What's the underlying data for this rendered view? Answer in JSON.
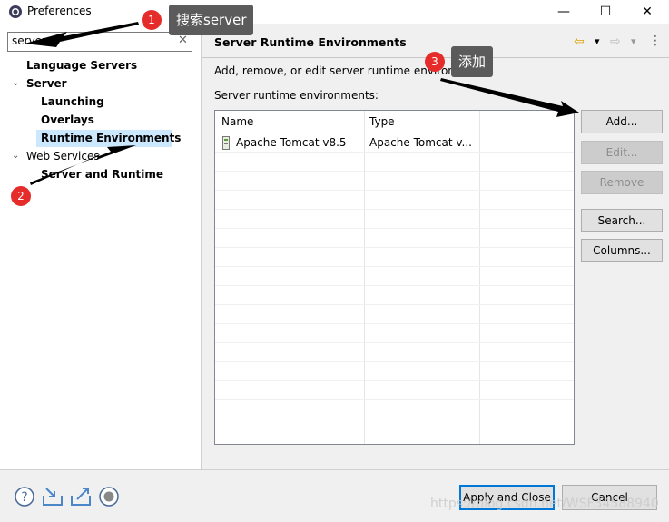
{
  "window": {
    "title": "Preferences",
    "minimize": "—",
    "maximize": "☐",
    "close": "✕"
  },
  "filter": {
    "value": "server",
    "clear": "✕"
  },
  "tree": [
    {
      "label": "Language Servers"
    },
    {
      "label": "Server",
      "chevron": "⌄"
    },
    {
      "label": "Launching"
    },
    {
      "label": "Overlays"
    },
    {
      "label": "Runtime Environments",
      "selected": true
    },
    {
      "label": "Web Services",
      "chevron": "⌄"
    },
    {
      "label": "Server and Runtime"
    }
  ],
  "page": {
    "title": "Server Runtime Environments",
    "description": "Add, remove, or edit server runtime environments.",
    "list_label": "Server runtime environments:",
    "nav": {
      "back": "⇦",
      "back_menu": "▾",
      "forward": "⇨",
      "forward_menu": "▾",
      "more": "⋮"
    }
  },
  "table": {
    "columns": [
      "Name",
      "Type"
    ],
    "rows": [
      {
        "name": "Apache Tomcat v8.5",
        "type": "Apache Tomcat v..."
      }
    ]
  },
  "buttons": {
    "add": "Add...",
    "edit": "Edit...",
    "remove": "Remove",
    "search": "Search...",
    "columns": "Columns..."
  },
  "footer": {
    "apply": "Apply and Close",
    "cancel": "Cancel",
    "watermark": "https://blog.csdn.net/WSF34588940"
  },
  "annotations": [
    {
      "num": "1",
      "text": "搜索server"
    },
    {
      "num": "2"
    },
    {
      "num": "3",
      "text": "添加"
    }
  ],
  "colors": {
    "selection": "#cce8ff",
    "default_button_border": "#0078d7",
    "annotation_red": "#e62b2b"
  }
}
